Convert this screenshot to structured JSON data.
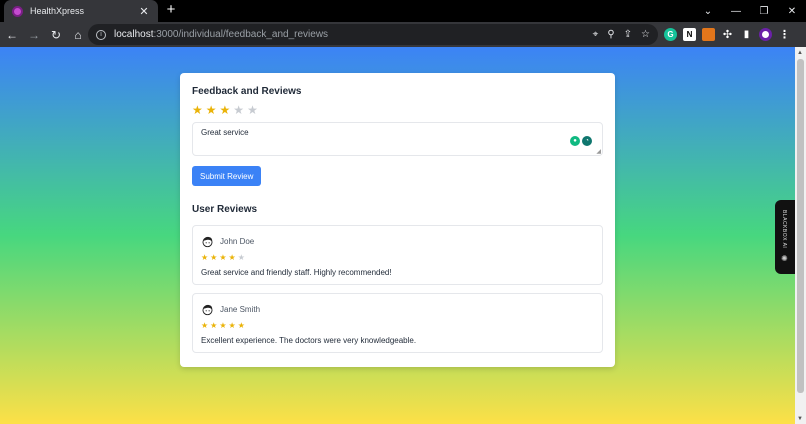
{
  "browser": {
    "tab_title": "HealthXpress",
    "tab_close": "✕",
    "new_tab": "+",
    "url_host": "localhost",
    "url_path": ":3000/individual/feedback_and_reviews",
    "window_controls": [
      "⌄",
      "—",
      "❐",
      "✕"
    ]
  },
  "feedback": {
    "title": "Feedback and Reviews",
    "rating": 3,
    "max_rating": 5,
    "review_text": "Great service",
    "submit_label": "Submit Review"
  },
  "reviews_section": {
    "title": "User Reviews",
    "reviews": [
      {
        "name": "John Doe",
        "rating": 4,
        "comment": "Great service and friendly staff. Highly recommended!"
      },
      {
        "name": "Jane Smith",
        "rating": 5,
        "comment": "Excellent experience. The doctors were very knowledgeable."
      }
    ]
  },
  "side_extension": {
    "label": "BLACKBOX AI"
  },
  "colors": {
    "primary": "#3b82f6",
    "star": "#eab308",
    "star_empty": "#c7cbd1"
  },
  "icons": {
    "back": "←",
    "forward": "→",
    "reload": "↻",
    "home": "⌂",
    "location": "⌖",
    "zoom": "⚲",
    "share": "⇪",
    "bookmark": "☆",
    "extensions": "✣",
    "sidepanel": "▮",
    "menu": "⋮",
    "info": "i"
  }
}
